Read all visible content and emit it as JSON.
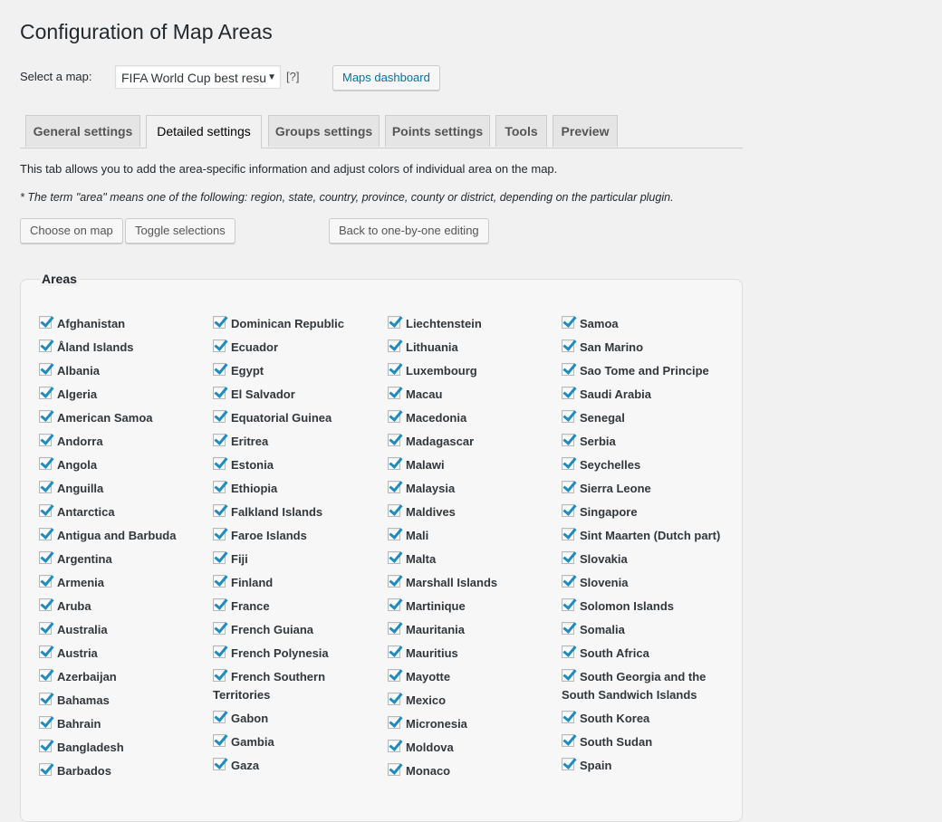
{
  "page": {
    "title": "Configuration of Map Areas"
  },
  "map_select": {
    "label": "Select a map:",
    "selected": "FIFA World Cup best resu",
    "arrow": "▼",
    "help": "[?]",
    "dashboard_button": "Maps dashboard"
  },
  "tabs": [
    {
      "label": "General settings",
      "active": false
    },
    {
      "label": "Detailed settings",
      "active": true
    },
    {
      "label": "Groups settings",
      "active": false
    },
    {
      "label": "Points settings",
      "active": false
    },
    {
      "label": "Tools",
      "active": false
    },
    {
      "label": "Preview",
      "active": false
    }
  ],
  "description": {
    "line1": "This tab allows you to add the area-specific information and adjust colors of individual area on the map.",
    "line2": "* The term \"area\" means one of the following: region, state, country, province, county or district, depending on the particular plugin."
  },
  "actions": {
    "choose_on_map": "Choose on map",
    "toggle_selections": "Toggle selections",
    "back_to_one_by_one": "Back to one-by-one editing"
  },
  "areas": {
    "legend": "Areas",
    "columns": [
      [
        "Afghanistan",
        "Åland Islands",
        "Albania",
        "Algeria",
        "American Samoa",
        "Andorra",
        "Angola",
        "Anguilla",
        "Antarctica",
        "Antigua and Barbuda",
        "Argentina",
        "Armenia",
        "Aruba",
        "Australia",
        "Austria",
        "Azerbaijan",
        "Bahamas",
        "Bahrain",
        "Bangladesh",
        "Barbados"
      ],
      [
        "Dominican Republic",
        "Ecuador",
        "Egypt",
        "El Salvador",
        "Equatorial Guinea",
        "Eritrea",
        "Estonia",
        "Ethiopia",
        "Falkland Islands",
        "Faroe Islands",
        "Fiji",
        "Finland",
        "France",
        "French Guiana",
        "French Polynesia",
        "French Southern Territories",
        "Gabon",
        "Gambia",
        "Gaza"
      ],
      [
        "Liechtenstein",
        "Lithuania",
        "Luxembourg",
        "Macau",
        "Macedonia",
        "Madagascar",
        "Malawi",
        "Malaysia",
        "Maldives",
        "Mali",
        "Malta",
        "Marshall Islands",
        "Martinique",
        "Mauritania",
        "Mauritius",
        "Mayotte",
        "Mexico",
        "Micronesia",
        "Moldova",
        "Monaco"
      ],
      [
        "Samoa",
        "San Marino",
        "Sao Tome and Principe",
        "Saudi Arabia",
        "Senegal",
        "Serbia",
        "Seychelles",
        "Sierra Leone",
        "Singapore",
        "Sint Maarten (Dutch part)",
        "Slovakia",
        "Slovenia",
        "Solomon Islands",
        "Somalia",
        "South Africa",
        "South Georgia and the South Sandwich Islands",
        "South Korea",
        "South Sudan",
        "Spain"
      ]
    ]
  }
}
